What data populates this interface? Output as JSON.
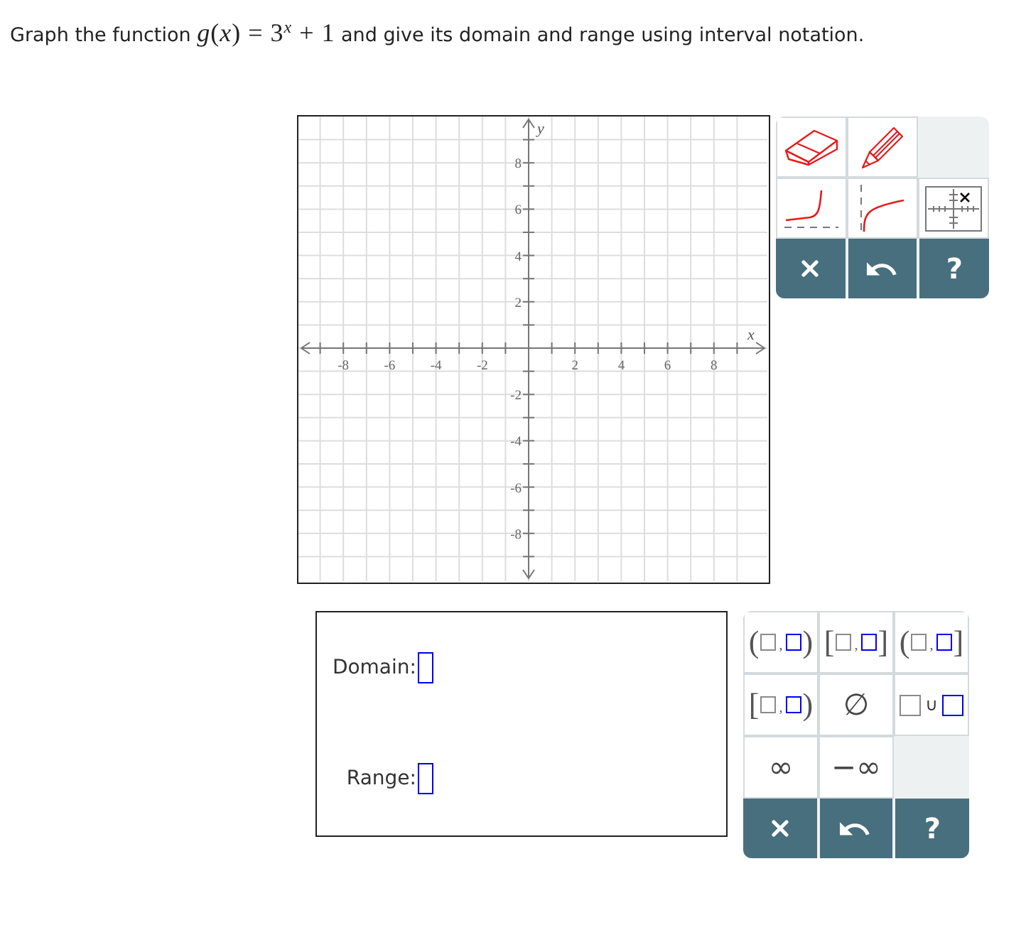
{
  "question": {
    "lead": "Graph the function",
    "formula": "*g*(*x*) = 3$^{x}$ + 1",
    "tail": "and give its domain and range using interval notation."
  },
  "graph": {
    "x_axis_label": "x",
    "y_axis_label": "y",
    "x_tick_labels": [
      "-8",
      "-6",
      "-4",
      "-2",
      "2",
      "4",
      "6",
      "8"
    ],
    "y_tick_labels": [
      "8",
      "6",
      "4",
      "2",
      "-2",
      "-4",
      "-6",
      "-8"
    ]
  },
  "graph_tools": {
    "tool_rows": [
      [
        {
          "kind": "eraser"
        },
        {
          "kind": "pencil"
        }
      ],
      [
        {
          "kind": "exponential"
        },
        {
          "kind": "logarithmic"
        },
        {
          "kind": "point"
        }
      ]
    ],
    "actions": [
      {
        "kind": "clear"
      },
      {
        "kind": "undo"
      },
      {
        "kind": "help",
        "label": "?"
      }
    ]
  },
  "answer_form": {
    "fields": [
      {
        "label": "Domain:"
      },
      {
        "label": "Range:"
      }
    ]
  },
  "interval_palette": {
    "rows": [
      [
        {
          "kind": "interval",
          "left": "(",
          "separator": ",",
          "right": ")"
        },
        {
          "kind": "interval",
          "left": "[",
          "separator": ",",
          "right": "]"
        },
        {
          "kind": "interval",
          "left": "(",
          "separator": ",",
          "right": "]"
        }
      ],
      [
        {
          "kind": "interval",
          "left": "[",
          "separator": ",",
          "right": ")"
        },
        {
          "kind": "symbol",
          "symbol": "∅"
        },
        {
          "kind": "union",
          "symbol": "∪"
        }
      ],
      [
        {
          "kind": "symbol",
          "symbol": "∞"
        },
        {
          "kind": "symbol",
          "symbol": "−∞"
        }
      ]
    ],
    "actions": [
      {
        "kind": "clear"
      },
      {
        "kind": "undo"
      },
      {
        "kind": "help",
        "label": "?"
      }
    ]
  }
}
